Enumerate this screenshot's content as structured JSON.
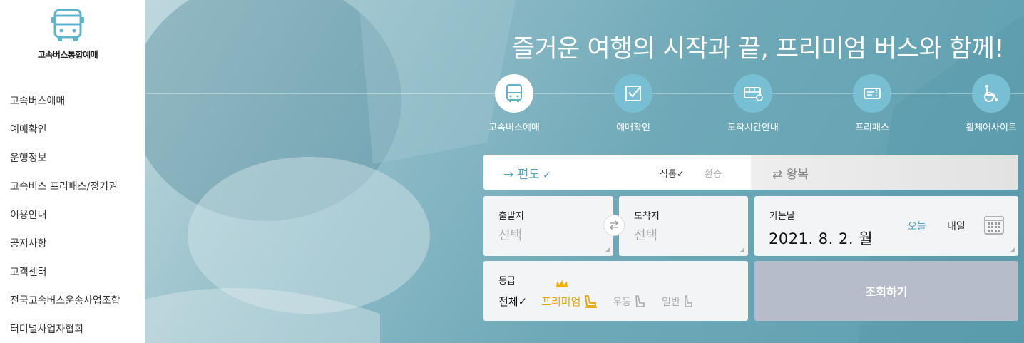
{
  "sidebar": {
    "logo_text": "고속버스통합예매",
    "items": [
      {
        "label": "고속버스예매"
      },
      {
        "label": "예매확인"
      },
      {
        "label": "운행정보"
      },
      {
        "label": "고속버스 프리패스/정기권"
      },
      {
        "label": "이용안내"
      },
      {
        "label": "공지사항"
      },
      {
        "label": "고객센터"
      },
      {
        "label": "전국고속버스운송사업조합"
      },
      {
        "label": "터미널사업자협회"
      }
    ]
  },
  "hero": {
    "headline": "즐거운 여행의 시작과 끝, 프리미엄 버스와 함께!",
    "menu": [
      {
        "label": "고속버스예매",
        "icon": "bus-icon",
        "active": true
      },
      {
        "label": "예매확인",
        "icon": "check-icon"
      },
      {
        "label": "도착시간안내",
        "icon": "bus-time-icon"
      },
      {
        "label": "프리패스",
        "icon": "ticket-icon"
      },
      {
        "label": "휠체어사이트",
        "icon": "wheelchair-icon"
      }
    ]
  },
  "booking": {
    "one_way": "편도",
    "one_way_check": "✓",
    "direct": "직통✓",
    "transfer": "환승",
    "round_trip": "왕복",
    "departure_label": "출발지",
    "departure_value": "선택",
    "arrival_label": "도착지",
    "arrival_value": "선택",
    "date_label": "가는날",
    "date_value": "2021. 8. 2. 월",
    "today": "오늘",
    "tomorrow": "내일",
    "grade_label": "등급",
    "grades": {
      "all": "전체✓",
      "premium": "프리미엄",
      "excellent": "우등",
      "normal": "일반"
    },
    "search_button": "조회하기"
  },
  "colors": {
    "accent": "#4ea3c6",
    "premium": "#e5a400",
    "search_button": "#b7bccb"
  }
}
